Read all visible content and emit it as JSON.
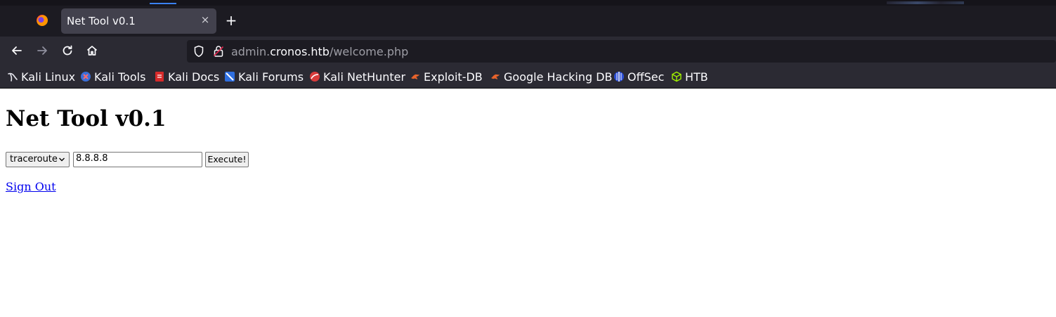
{
  "browser": {
    "tab_title": "Net Tool v0.1",
    "tab_close_glyph": "×",
    "new_tab_glyph": "+",
    "url": {
      "prefix": "admin.",
      "host": "cronos.htb",
      "path": "/welcome.php"
    },
    "icons": {
      "back": "back-arrow-icon",
      "forward": "forward-arrow-icon",
      "reload": "reload-icon",
      "home": "home-icon",
      "shield": "tracking-shield-icon",
      "lock": "insecure-lock-icon"
    },
    "bookmarks": [
      {
        "label": "Kali Linux",
        "icon": "kali-dragon-icon"
      },
      {
        "label": "Kali Tools",
        "icon": "kali-tools-icon"
      },
      {
        "label": "Kali Docs",
        "icon": "kali-docs-icon"
      },
      {
        "label": "Kali Forums",
        "icon": "kali-forums-icon"
      },
      {
        "label": "Kali NetHunter",
        "icon": "kali-nethunter-icon"
      },
      {
        "label": "Exploit-DB",
        "icon": "exploit-db-icon"
      },
      {
        "label": "Google Hacking DB",
        "icon": "ghdb-icon"
      },
      {
        "label": "OffSec",
        "icon": "offsec-icon"
      },
      {
        "label": "HTB",
        "icon": "htb-cube-icon"
      }
    ]
  },
  "page": {
    "title": "Net Tool v0.1",
    "command_select": {
      "selected": "traceroute"
    },
    "host_input": {
      "value": "8.8.8.8"
    },
    "execute_label": "Execute!",
    "signout_label": "Sign Out"
  },
  "colors": {
    "chrome_dark": "#1c1b22",
    "toolbar": "#2b2a33",
    "active_tab": "#42414d",
    "link": "#0000ee",
    "accent": "#3b82f6"
  }
}
